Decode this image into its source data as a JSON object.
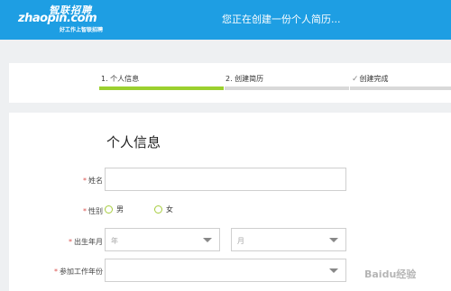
{
  "header": {
    "logo_cn": "智联招聘",
    "logo_en": "zhaopin.com",
    "logo_tagline": "好工作上智联招聘",
    "message": "您正在创建一份个人简历..."
  },
  "steps": [
    {
      "label": "1. 个人信息",
      "state": "active"
    },
    {
      "label": "2. 创建简历",
      "state": "pending"
    },
    {
      "label": "创建完成",
      "state": "pending",
      "icon": "check-icon"
    }
  ],
  "form": {
    "title": "个人信息",
    "required_mark": "*",
    "name_label": "姓名",
    "gender_label": "性别",
    "gender_options": [
      "男",
      "女"
    ],
    "birth_label": "出生年月",
    "birth_year_placeholder": "年",
    "birth_month_placeholder": "月",
    "work_start_label": "参加工作年份"
  },
  "watermark": "Baidu经验",
  "colors": {
    "brand": "#1e9ee3",
    "progress": "#9bd02f",
    "required": "#d9534f"
  }
}
